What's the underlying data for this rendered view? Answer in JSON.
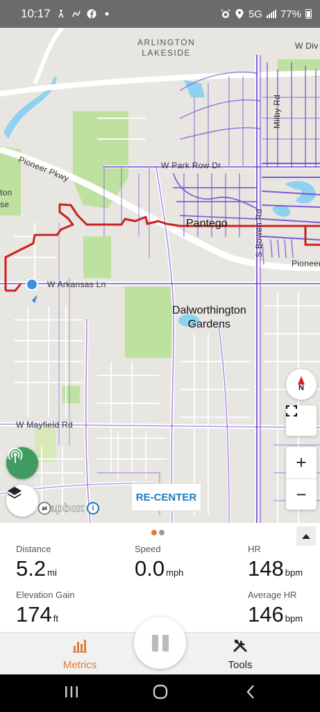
{
  "status_bar": {
    "time": "10:17",
    "network": "5G",
    "battery": "77%",
    "notification_icons": [
      "cycling-icon",
      "route-icon",
      "facebook-icon",
      "dot-icon"
    ],
    "system_icons": [
      "alarm-icon",
      "location-icon",
      "signal-icon",
      "battery-icon"
    ]
  },
  "map": {
    "labels": {
      "area_1": "ARLINGTON",
      "area_2": "LAKESIDE",
      "road_w_div": "W Div",
      "road_milby": "Milby Rd",
      "road_pioneer": "Pioneer Pkwy",
      "road_park_row": "W Park Row Dr",
      "left_fragment_1": "ton",
      "left_fragment_2": "se",
      "city_pantego": "Pantego",
      "road_bowen": "S Bowen Rd",
      "road_pioneer_right": "Pioneer",
      "road_arkansas": "W Arkansas Ln",
      "city_dalworthington_1": "Dalworthington",
      "city_dalworthington_2": "Gardens",
      "road_mayfield": "W Mayfield Rd"
    },
    "recenter_label": "RE-CENTER",
    "mapbox_label": "mapbox",
    "mapbox_info": "i",
    "compass_letter": "N",
    "zoom_in": "+",
    "zoom_out": "−",
    "colors": {
      "route": "#cc1f1f",
      "heatmap": "#6a3fd1",
      "park": "#bfe1a0",
      "water": "#8fd1f0",
      "road": "#ffffff"
    }
  },
  "metrics": {
    "page_indicator": {
      "active_color": "#e07b39",
      "inactive_color": "#9a9a9a"
    },
    "distance": {
      "label": "Distance",
      "value": "5.2",
      "unit": "mi"
    },
    "speed": {
      "label": "Speed",
      "value": "0.0",
      "unit": "mph"
    },
    "hr": {
      "label": "HR",
      "value": "148",
      "unit": "bpm"
    },
    "elevation_gain": {
      "label": "Elevation Gain",
      "value": "174",
      "unit": "ft"
    },
    "average_hr": {
      "label": "Average HR",
      "value": "146",
      "unit": "bpm"
    }
  },
  "bottom_nav": {
    "metrics_label": "Metrics",
    "tools_label": "Tools",
    "active_color": "#e07b39"
  }
}
